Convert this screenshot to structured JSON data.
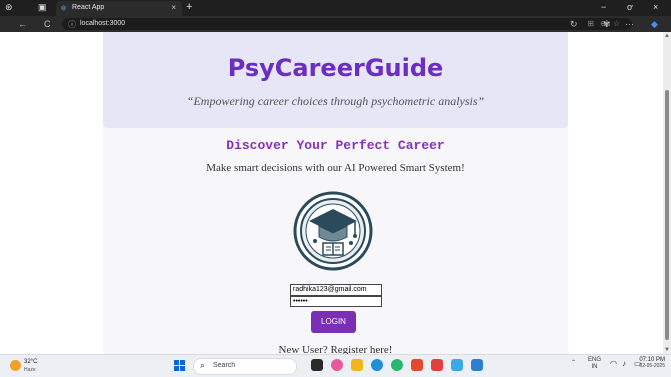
{
  "browser": {
    "tab_title": "React App",
    "tab_close": "×",
    "new_tab": "+",
    "url": "localhost:3000",
    "info_icon": "ⓘ",
    "back_icon": "←",
    "reload_icon": "C",
    "minimize": "−",
    "restore": "ơ",
    "close": "×"
  },
  "app": {
    "brand": "PsyCareerGuide",
    "tagline": "“Empowering career choices through psychometric analysis”",
    "heading": "Discover Your Perfect Career",
    "subtitle": "Make smart decisions with our AI Powered Smart System!",
    "email_value": "radhika123@gmail.com",
    "password_value": "••••••",
    "login_label": "LOGIN",
    "register_text": "New User? Register here!"
  },
  "taskbar": {
    "weather_temp": "32°C",
    "weather_cond": "Haze",
    "search_placeholder": "Search",
    "tray_lang": "ENG",
    "tray_region": "IN",
    "time": "07:10 PM",
    "date": "02-05-2025"
  },
  "colors": {
    "brand": "#6a2fc0",
    "accent": "#7b2fb5",
    "header_bg": "#e6e6f6"
  }
}
